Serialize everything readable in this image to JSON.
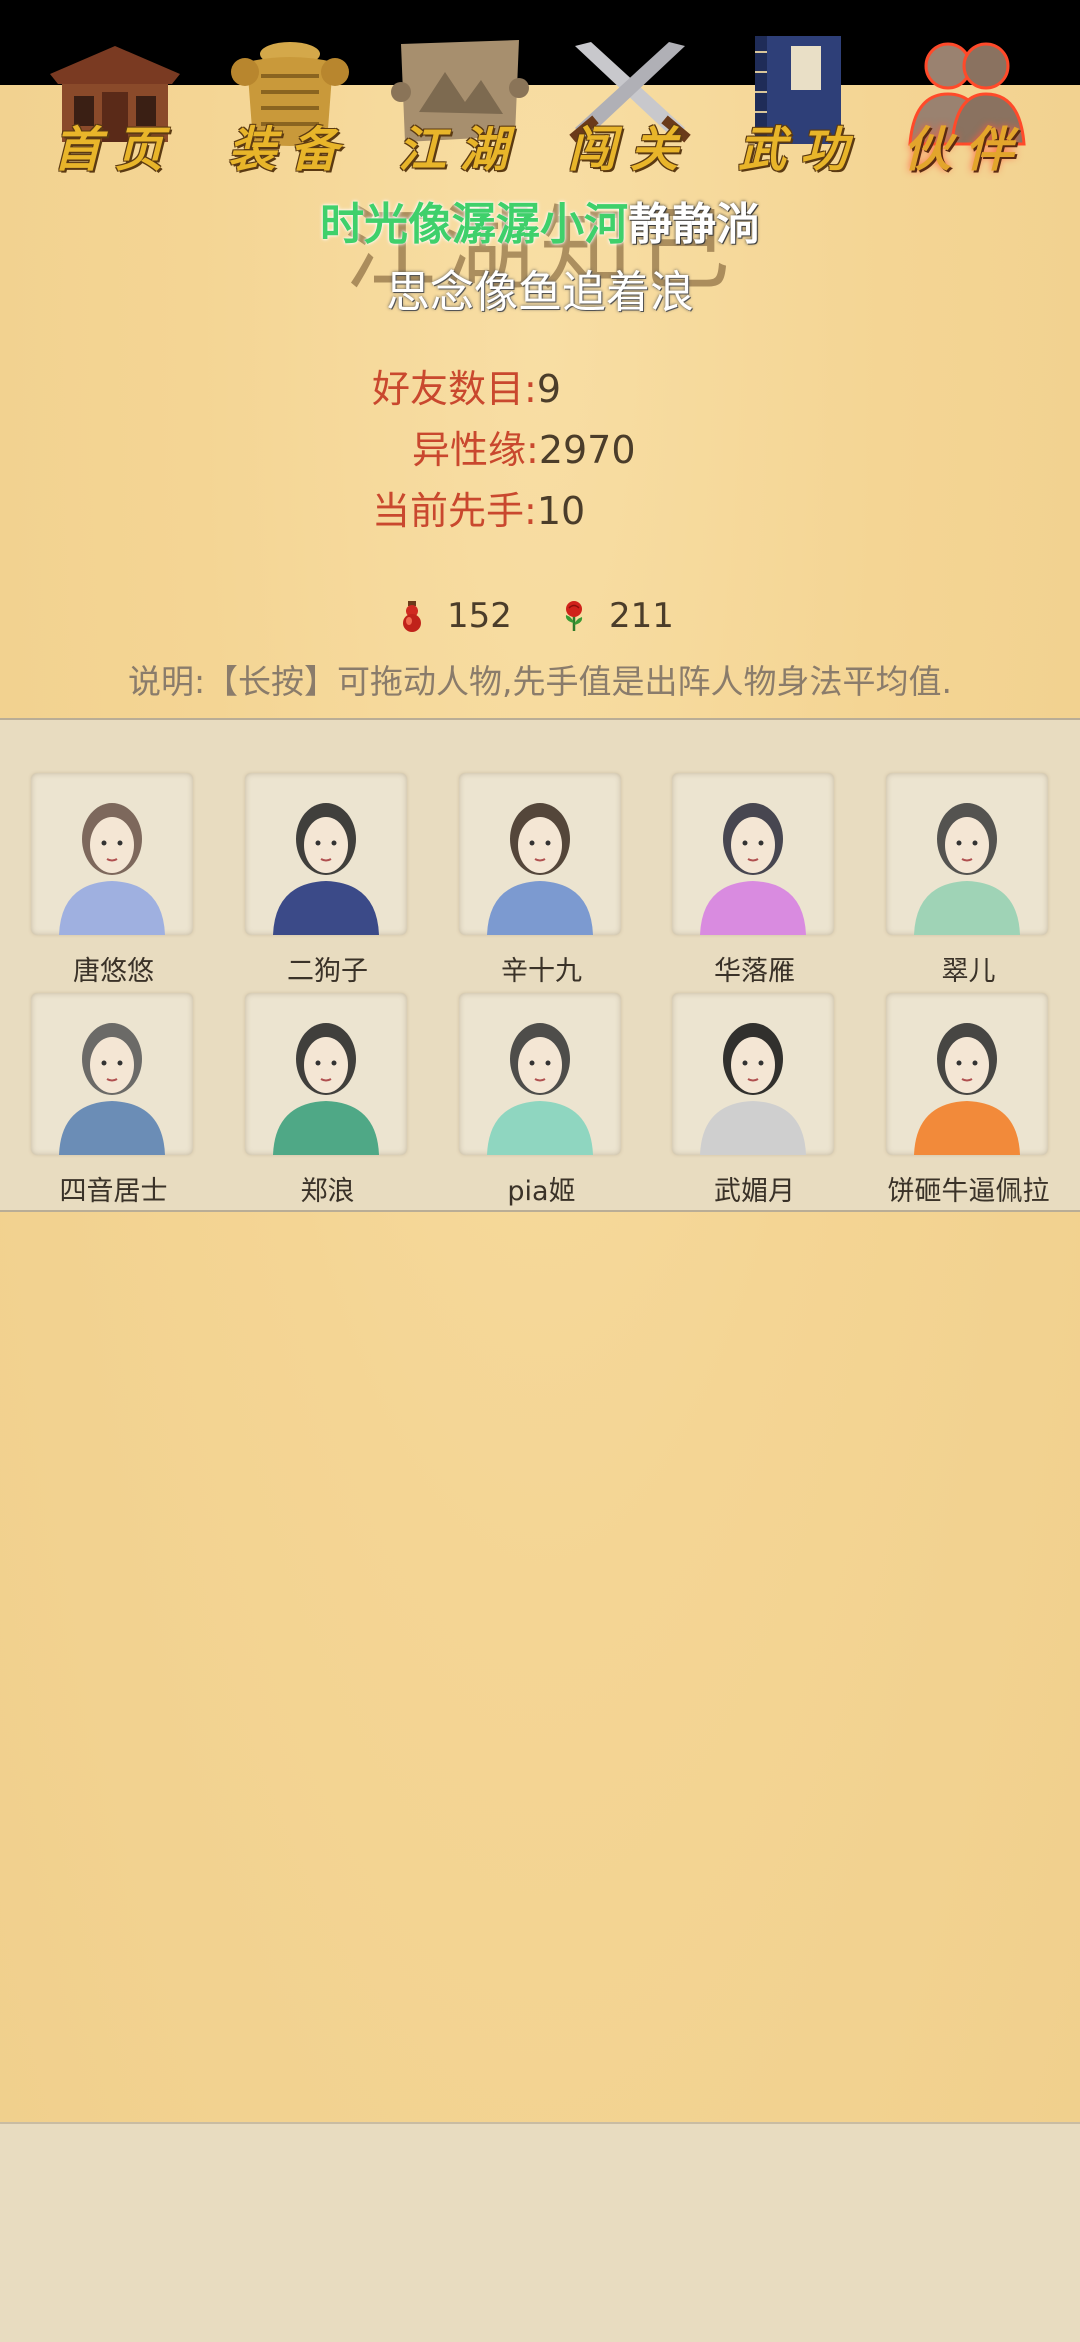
{
  "page": {
    "title": "江湖知己",
    "lyrics": {
      "line1_highlight": "时光像潺潺小河",
      "line1_rest": "静静淌",
      "line2": "思念像鱼追着浪"
    }
  },
  "stats": [
    {
      "label": "好友数目:",
      "value": "9"
    },
    {
      "label": "异性缘:",
      "value": "2970"
    },
    {
      "label": "当前先手:",
      "value": "10"
    }
  ],
  "currency": {
    "gourd": {
      "icon": "red-gourd-icon",
      "value": "152"
    },
    "rose": {
      "icon": "rose-icon",
      "value": "211"
    }
  },
  "hint": "说明:【长按】可拖动人物,先手值是出阵人物身法平均值.",
  "friends": [
    {
      "name": "唐悠悠",
      "clothes": "#9fb0e0",
      "hair": "#6a5248"
    },
    {
      "name": "二狗子",
      "clothes": "#3b4a88",
      "hair": "#222"
    },
    {
      "name": "辛十九",
      "clothes": "#7c9ad0",
      "hair": "#3a2a20"
    },
    {
      "name": "华落雁",
      "clothes": "#d98be0",
      "hair": "#2a2a3a"
    },
    {
      "name": "翠儿",
      "clothes": "#9fd3b6",
      "hair": "#3a3a3a"
    },
    {
      "name": "四音居士",
      "clothes": "#6b8db6",
      "hair": "#555"
    },
    {
      "name": "郑浪",
      "clothes": "#4fa886",
      "hair": "#222"
    },
    {
      "name": "pia姬",
      "clothes": "#8fd6c0",
      "hair": "#333"
    },
    {
      "name": "武媚月",
      "clothes": "#cfcfcf",
      "hair": "#111"
    },
    {
      "name": "饼砸牛逼佩拉",
      "clothes": "#f28a3a",
      "hair": "#2a2a2a"
    }
  ],
  "nav": [
    {
      "label": "首页",
      "icon": "house-icon"
    },
    {
      "label": "装备",
      "icon": "armor-icon"
    },
    {
      "label": "江湖",
      "icon": "scroll-map-icon"
    },
    {
      "label": "闯关",
      "icon": "crossed-swords-icon"
    },
    {
      "label": "武功",
      "icon": "book-icon"
    },
    {
      "label": "伙伴",
      "icon": "companions-icon",
      "active": true
    }
  ],
  "colors": {
    "accent_label": "#c9482e",
    "lyric_highlight": "#3fd06b",
    "nav_text": "#e8b52a"
  }
}
